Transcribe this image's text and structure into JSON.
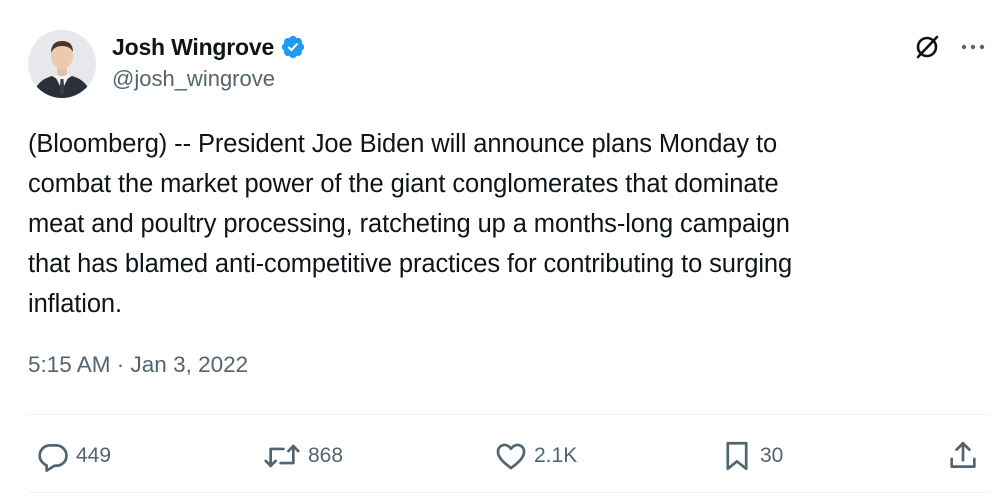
{
  "author": {
    "display_name": "Josh Wingrove",
    "handle": "@josh_wingrove",
    "verified": true,
    "verified_color": "#1d9bf0"
  },
  "tweet": {
    "text": "(Bloomberg) -- President Joe Biden will announce plans Monday to\ncombat the market power of the giant conglomerates that dominate\nmeat and poultry processing, ratcheting up a months-long campaign\nthat has blamed anti-competitive practices for contributing to surging\ninflation.",
    "timestamp": "5:15 AM · Jan 3, 2022"
  },
  "header_icons": [
    "grok-icon",
    "more-icon"
  ],
  "actions": {
    "replies": {
      "icon": "reply-icon",
      "count": "449"
    },
    "reposts": {
      "icon": "repost-icon",
      "count": "868"
    },
    "likes": {
      "icon": "heart-icon",
      "count": "2.1K"
    },
    "bookmarks": {
      "icon": "bookmark-icon",
      "count": "30"
    },
    "share": {
      "icon": "share-icon"
    }
  },
  "colors": {
    "text_primary": "#0f1419",
    "text_secondary": "#536471",
    "divider": "#eff3f4"
  }
}
